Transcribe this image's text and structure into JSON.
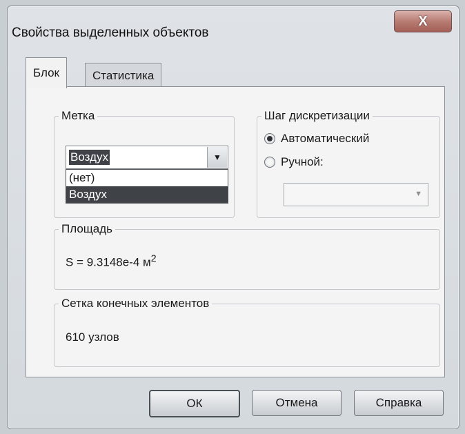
{
  "window": {
    "title": "Свойства выделенных объектов",
    "close_label": "X"
  },
  "tabs": [
    {
      "label": "Блок",
      "active": true
    },
    {
      "label": "Статистика",
      "active": false
    }
  ],
  "metka": {
    "label": "Метка",
    "selected_value": "Воздух",
    "options": [
      "(нет)",
      "Воздух"
    ]
  },
  "shag": {
    "label": "Шаг дискретизации",
    "options": [
      {
        "label": "Автоматический",
        "checked": true
      },
      {
        "label": "Ручной:",
        "checked": false
      }
    ],
    "manual_value": ""
  },
  "area": {
    "label": "Площадь",
    "value_prefix": "S = 9.3148e-4 м",
    "value_sup": "2"
  },
  "mesh": {
    "label": "Сетка конечных элементов",
    "value": "610 узлов"
  },
  "buttons": {
    "ok": "ОК",
    "cancel": "Отмена",
    "help": "Справка"
  }
}
